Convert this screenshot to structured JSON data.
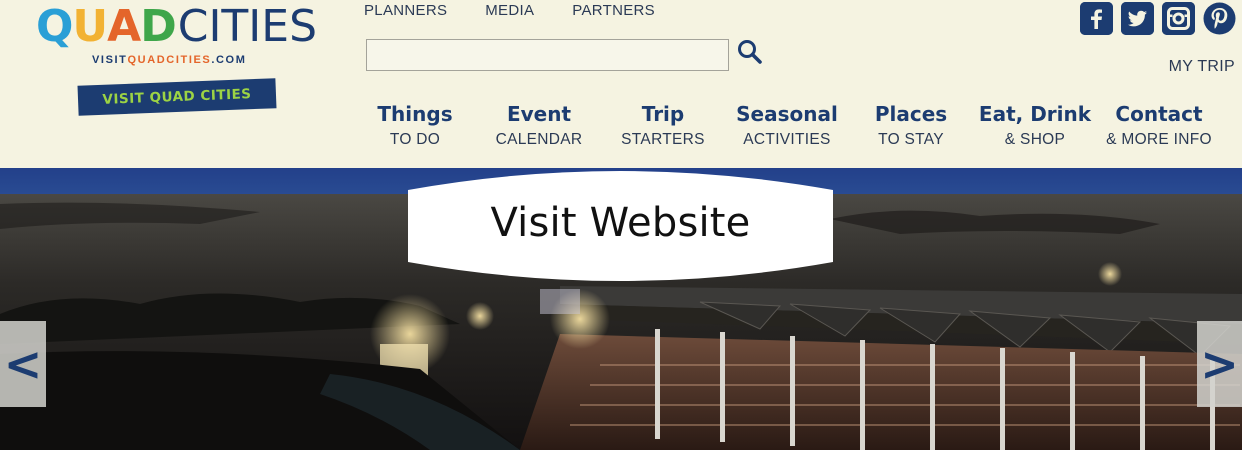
{
  "logo": {
    "letters": [
      {
        "char": "Q",
        "color": "#2a9fd6"
      },
      {
        "char": "U",
        "color": "#f2b233"
      },
      {
        "char": "A",
        "color": "#e4652a"
      },
      {
        "char": "D",
        "color": "#3fa64a"
      }
    ],
    "cities": "CITIES",
    "url_prefix": "VISIT",
    "url_accent": "QUADCITIES",
    "url_suffix": ".COM",
    "badge": "VISIT QUAD CITIES"
  },
  "top_links": [
    "PLANNERS",
    "MEDIA",
    "PARTNERS"
  ],
  "search": {
    "value": "",
    "placeholder": ""
  },
  "social": [
    "f",
    "t",
    "ig",
    "p"
  ],
  "my_trip": "MY TRIP",
  "nav": [
    {
      "main": "Things",
      "sub": "TO DO"
    },
    {
      "main": "Event",
      "sub": "CALENDAR"
    },
    {
      "main": "Trip",
      "sub": "STARTERS"
    },
    {
      "main": "Seasonal",
      "sub": "ACTIVITIES"
    },
    {
      "main": "Places",
      "sub": "TO STAY"
    },
    {
      "main": "Eat, Drink",
      "sub": "& SHOP"
    },
    {
      "main": "Contact",
      "sub": "& MORE INFO"
    }
  ],
  "hero": {
    "cta": "Visit Website",
    "prev": "<",
    "next": ">"
  },
  "colors": {
    "brand_navy": "#1c3c71",
    "badge_green": "#9cd344",
    "header_bg": "#f5f3e1",
    "band_blue": "#294b92"
  }
}
